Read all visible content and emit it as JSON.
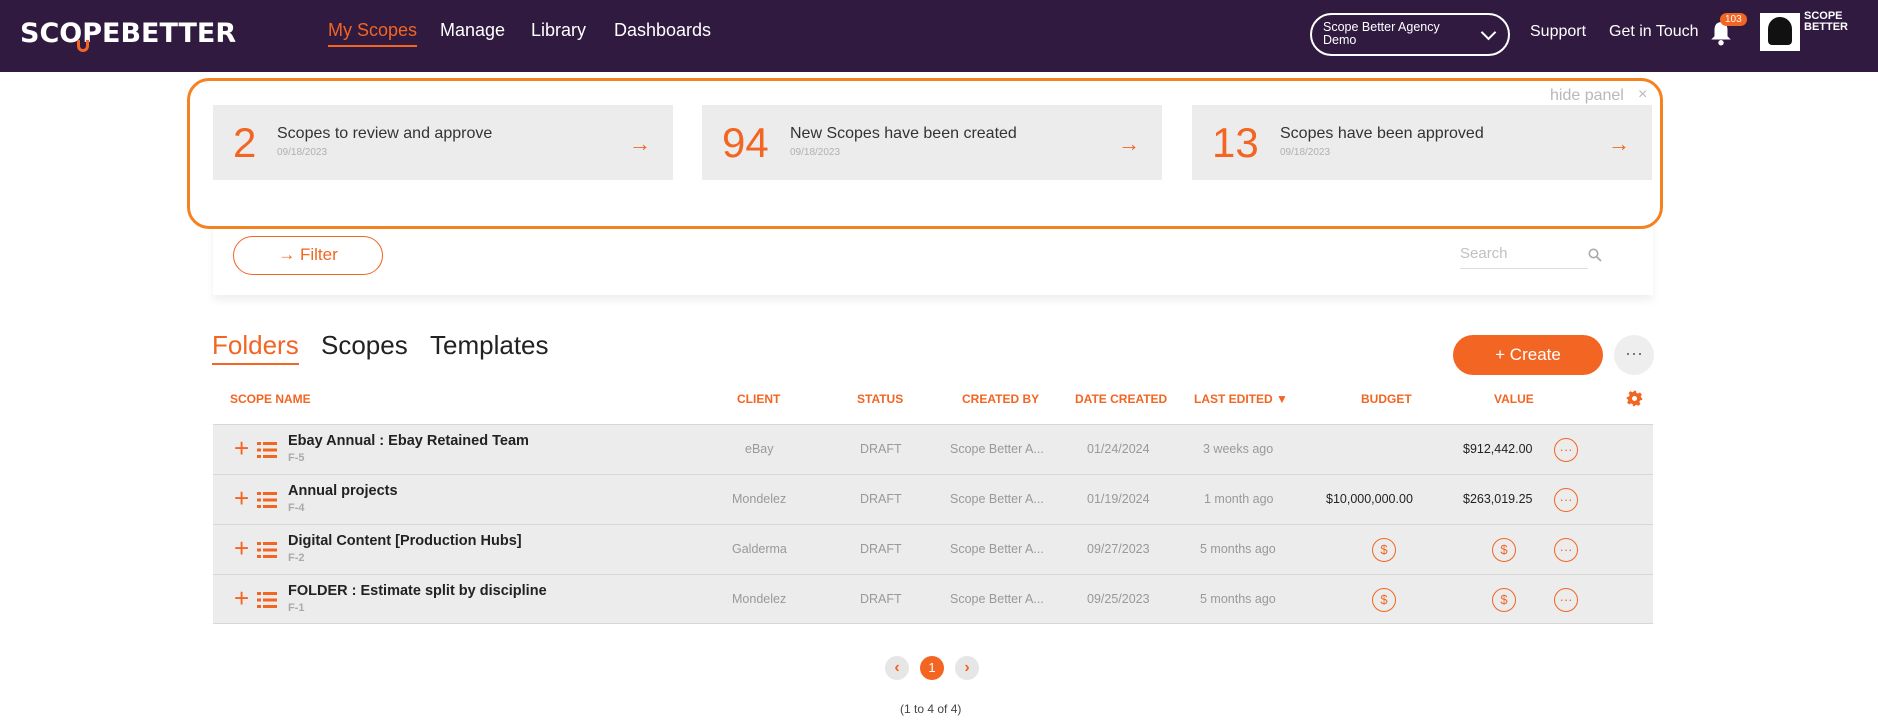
{
  "header": {
    "logo": "SCOPEBETTER",
    "nav": [
      {
        "label": "My Scopes",
        "active": true
      },
      {
        "label": "Manage"
      },
      {
        "label": "Library"
      },
      {
        "label": "Dashboards"
      }
    ],
    "agency_select": "Scope Better Agency Demo",
    "support": "Support",
    "get_in_touch": "Get in Touch",
    "notification_count": "103",
    "avatar_logo": "SCOPE BETTER"
  },
  "summary": {
    "hide_label": "hide panel",
    "close": "×",
    "cards": [
      {
        "count": "2",
        "title": "Scopes to review and approve",
        "date": "09/18/2023"
      },
      {
        "count": "94",
        "title": "New Scopes have been created",
        "date": "09/18/2023"
      },
      {
        "count": "13",
        "title": "Scopes have been approved",
        "date": "09/18/2023"
      }
    ]
  },
  "filter": {
    "label": "→ Filter",
    "search_placeholder": "Search"
  },
  "tabs": [
    {
      "label": "Folders",
      "active": true
    },
    {
      "label": "Scopes"
    },
    {
      "label": "Templates"
    }
  ],
  "create_label": "+ Create",
  "more_label": "···",
  "table": {
    "columns": [
      "SCOPE NAME",
      "CLIENT",
      "STATUS",
      "CREATED BY",
      "DATE CREATED",
      "LAST EDITED ▼",
      "BUDGET",
      "VALUE"
    ],
    "rows": [
      {
        "name": "Ebay Annual : Ebay Retained Team",
        "code": "F-5",
        "client": "eBay",
        "status": "DRAFT",
        "created_by": "Scope Better A...",
        "date_created": "01/24/2024",
        "last_edited": "3 weeks ago",
        "budget": "",
        "value": "$912,442.00"
      },
      {
        "name": "Annual projects",
        "code": "F-4",
        "client": "Mondelez",
        "status": "DRAFT",
        "created_by": "Scope Better A...",
        "date_created": "01/19/2024",
        "last_edited": "1 month ago",
        "budget": "$10,000,000.00",
        "value": "$263,019.25"
      },
      {
        "name": "Digital Content [Production Hubs]",
        "code": "F-2",
        "client": "Galderma",
        "status": "DRAFT",
        "created_by": "Scope Better A...",
        "date_created": "09/27/2023",
        "last_edited": "5 months ago",
        "budget": "$",
        "value": "$"
      },
      {
        "name": "FOLDER : Estimate split by discipline",
        "code": "F-1",
        "client": "Mondelez",
        "status": "DRAFT",
        "created_by": "Scope Better A...",
        "date_created": "09/25/2023",
        "last_edited": "5 months ago",
        "budget": "$",
        "value": "$"
      }
    ]
  },
  "pagination": {
    "prev": "‹",
    "current": "1",
    "next": "›",
    "info": "(1 to 4 of 4)"
  },
  "colors": {
    "accent": "#f26522",
    "header_bg": "#301a40"
  }
}
